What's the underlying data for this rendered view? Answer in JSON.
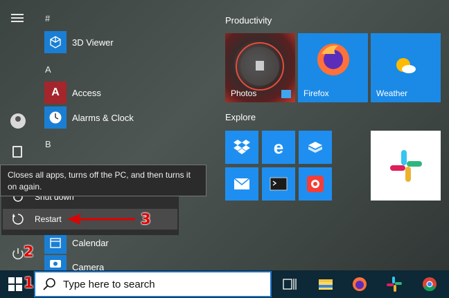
{
  "app_list": {
    "letters": [
      "#",
      "A",
      "B"
    ],
    "apps": [
      {
        "label": "3D Viewer",
        "icon": "3d-viewer-icon"
      },
      {
        "label": "Access",
        "icon": "access-icon"
      },
      {
        "label": "Alarms & Clock",
        "icon": "alarms-clock-icon"
      },
      {
        "label": "Calendar",
        "icon": "calendar-icon"
      },
      {
        "label": "Camera",
        "icon": "camera-icon"
      }
    ]
  },
  "tiles": {
    "groups": [
      {
        "label": "Productivity"
      },
      {
        "label": "Explore"
      }
    ],
    "large": [
      {
        "label": "Photos",
        "icon": "photos-icon"
      },
      {
        "label": "Firefox",
        "icon": "firefox-icon"
      },
      {
        "label": "Weather",
        "icon": "weather-icon"
      }
    ],
    "explore_small": [
      "dropbox-icon",
      "edge-icon",
      "sandbox-icon",
      "mail-icon",
      "terminal-icon",
      "pocketcasts-icon"
    ],
    "explore_large": {
      "icon": "slack-icon"
    }
  },
  "power_menu": {
    "tooltip": "Closes all apps, turns off the PC, and then turns it on again.",
    "items": [
      {
        "label": "Shut down",
        "icon": "shutdown-icon"
      },
      {
        "label": "Restart",
        "icon": "restart-icon"
      }
    ]
  },
  "annotations": {
    "one": "1",
    "two": "2",
    "three": "3"
  },
  "taskbar": {
    "search_placeholder": "Type here to search",
    "pinned": [
      "task-view-icon",
      "file-explorer-icon",
      "firefox-icon",
      "slack-icon",
      "chrome-icon"
    ]
  },
  "colors": {
    "accent": "#1d73c7",
    "tile_blue": "#1a8ae6",
    "taskbar": "#0d2836",
    "annotation_red": "#e00000"
  }
}
